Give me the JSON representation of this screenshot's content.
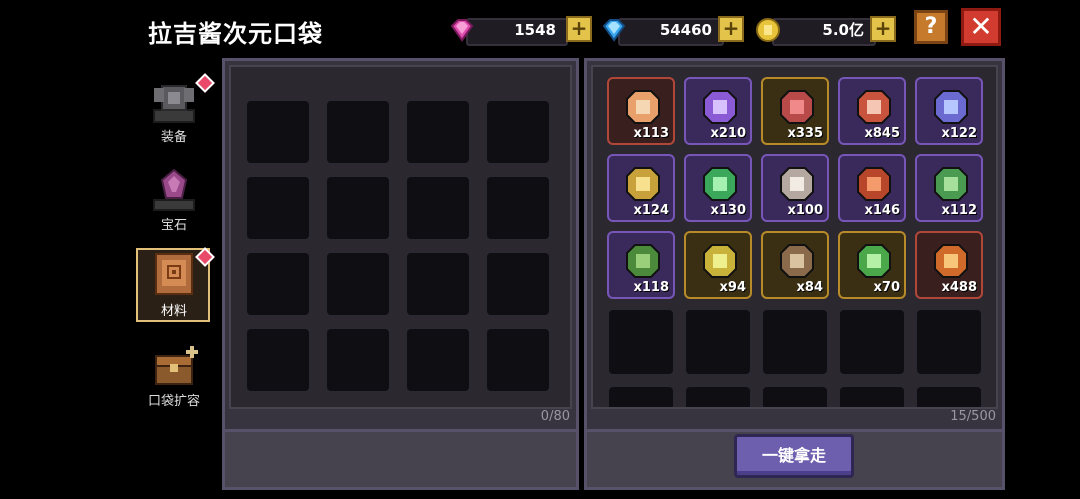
{
  "title": "拉吉酱次元口袋",
  "currency": {
    "gems": "1548",
    "diamonds": "54460",
    "coins": "5.0亿"
  },
  "buttons": {
    "help": "?",
    "close": "✕",
    "plus": "+",
    "take_all": "一键拿走"
  },
  "tabs": [
    {
      "label": "装备",
      "icon": "armor-icon",
      "notify": true
    },
    {
      "label": "宝石",
      "icon": "gem-altar-icon",
      "notify": false
    },
    {
      "label": "材料",
      "icon": "materials-icon",
      "notify": true,
      "active": true
    },
    {
      "label": "口袋扩容",
      "icon": "chest-expand-icon",
      "notify": false
    }
  ],
  "left_panel": {
    "count": "0/80"
  },
  "right_panel": {
    "count": "15/500",
    "items": [
      {
        "qty": "x113",
        "rarity": "red",
        "icon": "crystal-ore-icon"
      },
      {
        "qty": "x210",
        "rarity": "purple",
        "icon": "purple-rune-icon"
      },
      {
        "qty": "x335",
        "rarity": "gold",
        "icon": "red-gem-icon"
      },
      {
        "qty": "x845",
        "rarity": "purple",
        "icon": "red-token-icon"
      },
      {
        "qty": "x122",
        "rarity": "purple",
        "icon": "blue-device-icon"
      },
      {
        "qty": "x124",
        "rarity": "purple",
        "icon": "gold-bell-icon"
      },
      {
        "qty": "x130",
        "rarity": "purple",
        "icon": "green-slime-icon"
      },
      {
        "qty": "x100",
        "rarity": "purple",
        "icon": "bone-icon"
      },
      {
        "qty": "x146",
        "rarity": "purple",
        "icon": "red-orb-icon"
      },
      {
        "qty": "x112",
        "rarity": "purple",
        "icon": "green-gadget-icon"
      },
      {
        "qty": "x118",
        "rarity": "purple",
        "icon": "green-leaf-icon"
      },
      {
        "qty": "x94",
        "rarity": "gold",
        "icon": "gold-bell-big-icon"
      },
      {
        "qty": "x84",
        "rarity": "gold",
        "icon": "pickaxe-icon"
      },
      {
        "qty": "x70",
        "rarity": "gold",
        "icon": "green-scroll-icon"
      },
      {
        "qty": "x488",
        "rarity": "red",
        "icon": "orange-shield-icon"
      }
    ]
  }
}
